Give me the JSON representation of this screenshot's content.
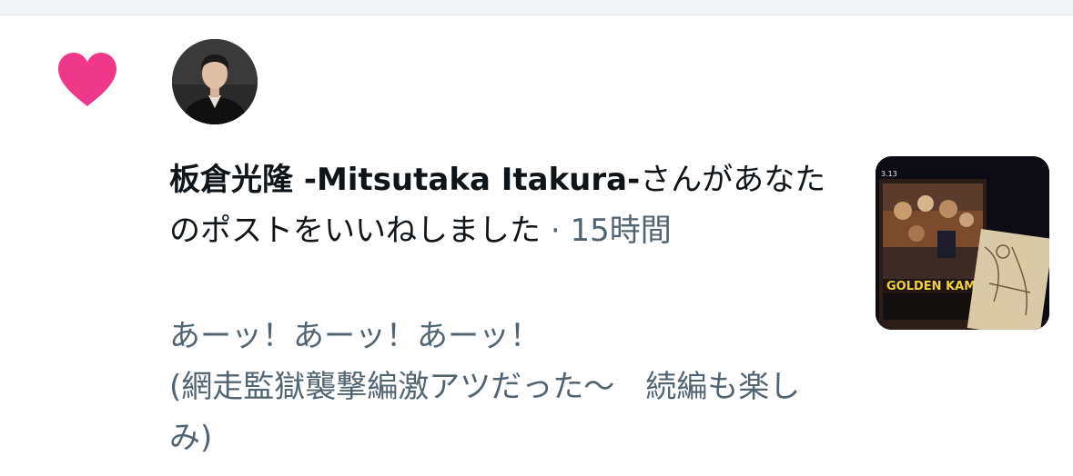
{
  "notification": {
    "author_name": "板倉光隆 -Mitsutaka Itakura-",
    "action_text": "さんがあなたのポストをいいねしました",
    "separator": "·",
    "timestamp": "15時間",
    "quoted_post_text": "あーッ！あーッ！あーッ！\n(網走監獄襲撃編激アツだった〜　続編も楽しみ)",
    "icon": "heart-icon",
    "heart_color": "#F0388A",
    "thumbnail_text": {
      "poster_title": "GOLDEN KAMU",
      "date_label": "3.13"
    }
  },
  "colors": {
    "primary_text": "#0F1419",
    "secondary_text": "#536471",
    "top_strip": "#F2F3F5"
  }
}
